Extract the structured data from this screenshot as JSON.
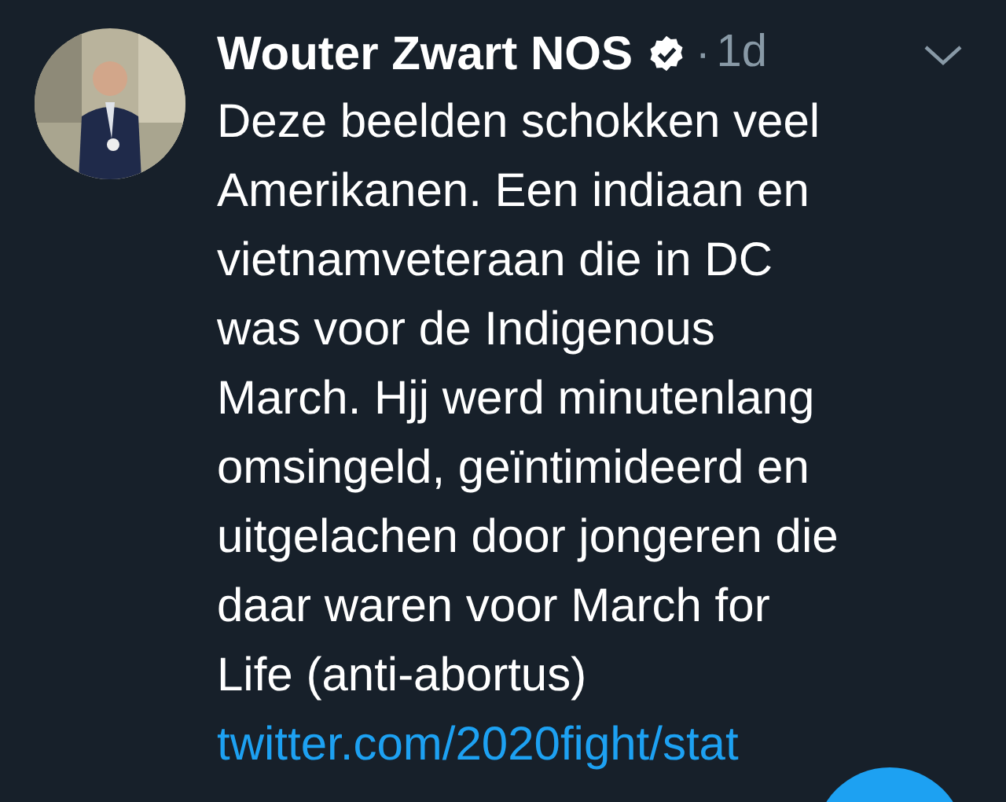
{
  "tweet": {
    "author": "Wouter Zwart NOS",
    "verified": true,
    "separator": "·",
    "time": "1d",
    "text_lines": [
      "Deze beelden schokken veel",
      "Amerikanen. Een indiaan en",
      "vietnamveteraan die in DC",
      "was voor de Indigenous",
      "March. Hjj werd minutenlang",
      "omsingeld, geïntimideerd en",
      "uitgelachen door jongeren die",
      "daar waren voor March for",
      "Life (anti-abortus)"
    ],
    "link": "twitter.com/2020fight/stat"
  }
}
